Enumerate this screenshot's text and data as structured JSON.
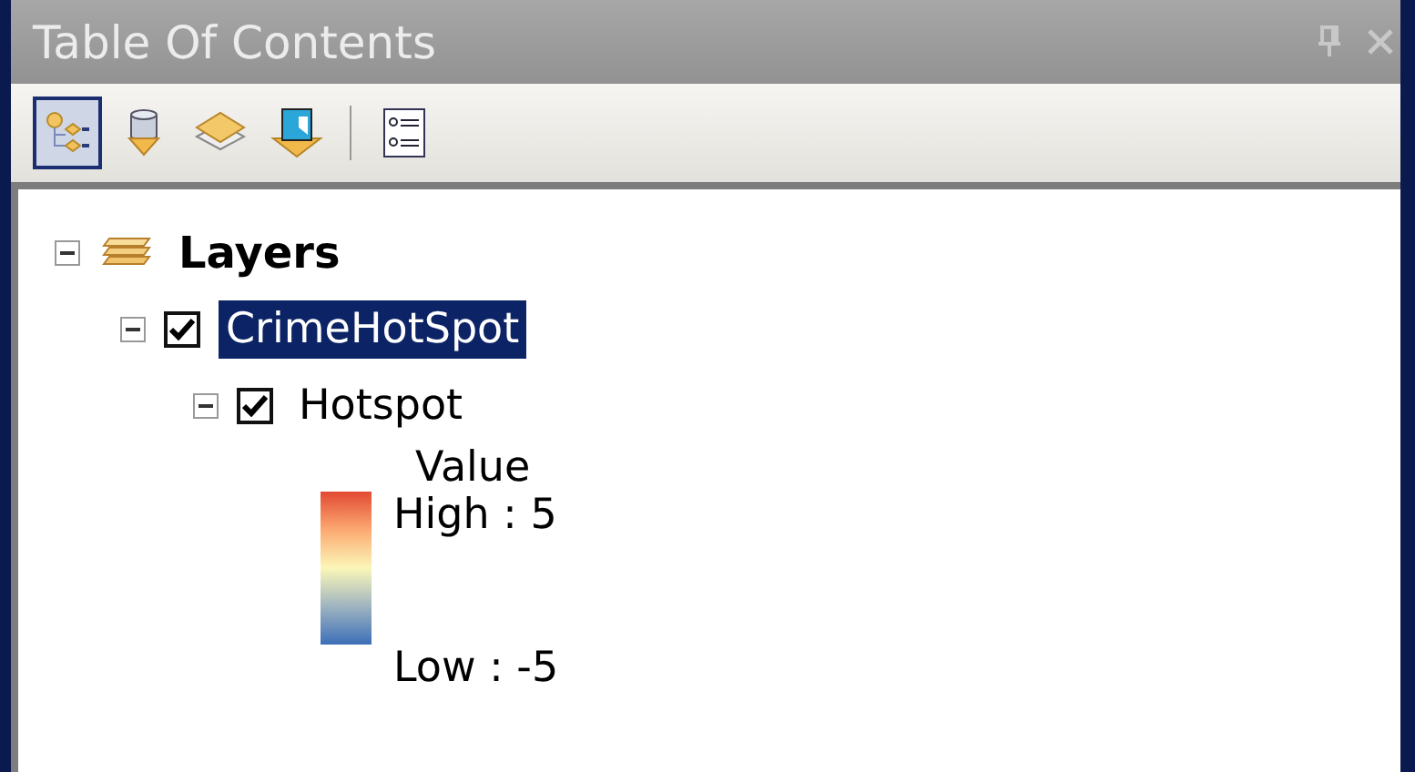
{
  "window": {
    "title": "Table Of Contents"
  },
  "toolbar": {
    "buttons": [
      {
        "kind": "drawing-order",
        "selected": true
      },
      {
        "kind": "source",
        "selected": false
      },
      {
        "kind": "visibility",
        "selected": false
      },
      {
        "kind": "selection",
        "selected": false
      },
      {
        "kind": "options",
        "selected": false
      }
    ]
  },
  "tree": {
    "label": "Layers",
    "expanded": true,
    "children": [
      {
        "label": "CrimeHotSpot",
        "checked": true,
        "selected": true,
        "expanded": true,
        "children": [
          {
            "label": "Hotspot",
            "checked": true,
            "selected": false,
            "expanded": true,
            "legend": {
              "heading": "Value",
              "high": "High : 5",
              "low": "Low : -5"
            }
          }
        ]
      }
    ]
  }
}
